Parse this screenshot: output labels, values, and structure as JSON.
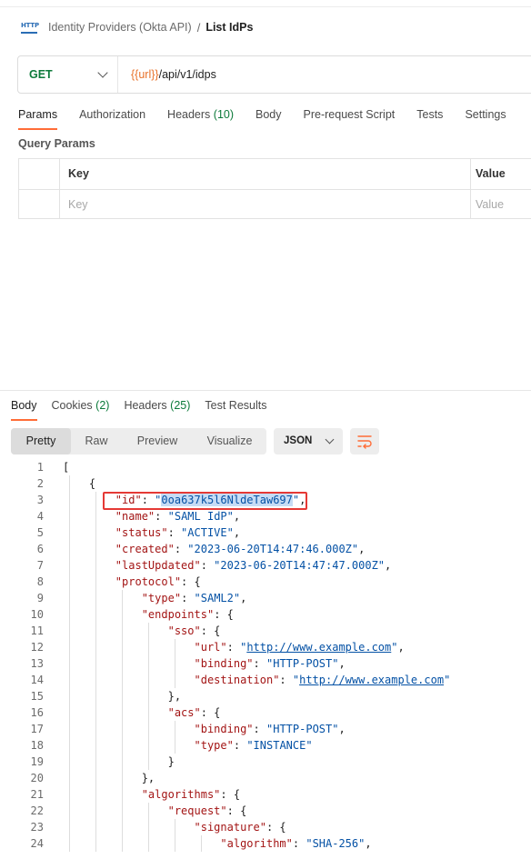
{
  "breadcrumb": {
    "icon": "http-icon",
    "icon_text": "HTTP",
    "parent": "Identity Providers (Okta API)",
    "separator": "/",
    "current": "List IdPs"
  },
  "request": {
    "method": "GET",
    "url_var": "{{url}}",
    "url_path": "/api/v1/idps"
  },
  "request_tabs": [
    {
      "label": "Params",
      "count": ""
    },
    {
      "label": "Authorization",
      "count": ""
    },
    {
      "label": "Headers",
      "count": "(10)"
    },
    {
      "label": "Body",
      "count": ""
    },
    {
      "label": "Pre-request Script",
      "count": ""
    },
    {
      "label": "Tests",
      "count": ""
    },
    {
      "label": "Settings",
      "count": ""
    }
  ],
  "query_params": {
    "title": "Query Params",
    "headers": {
      "key": "Key",
      "value": "Value"
    },
    "placeholders": {
      "key": "Key",
      "value": "Value"
    }
  },
  "response_tabs": [
    {
      "label": "Body",
      "count": ""
    },
    {
      "label": "Cookies",
      "count": "(2)"
    },
    {
      "label": "Headers",
      "count": "(25)"
    },
    {
      "label": "Test Results",
      "count": ""
    }
  ],
  "view_modes": [
    "Pretty",
    "Raw",
    "Preview",
    "Visualize"
  ],
  "format": "JSON",
  "colors": {
    "accent": "#ff6c37",
    "method_get": "#0c7a3a",
    "url_variable": "#e8722a",
    "json_key": "#a31515",
    "json_string": "#0451a5",
    "highlight_box": "#e53935"
  },
  "json": {
    "id": "0oa637k5l6NldeTaw697",
    "name": "SAML IdP",
    "status": "ACTIVE",
    "created": "2023-06-20T14:47:46.000Z",
    "lastUpdated": "2023-06-20T14:47:47.000Z",
    "protocol_type": "SAML2",
    "sso_url": "http://www.example.com",
    "sso_binding": "HTTP-POST",
    "sso_destination": "http://www.example.com",
    "acs_binding": "HTTP-POST",
    "acs_type": "INSTANCE",
    "signature_algorithm": "SHA-256"
  },
  "line_numbers": [
    "1",
    "2",
    "3",
    "4",
    "5",
    "6",
    "7",
    "8",
    "9",
    "10",
    "11",
    "12",
    "13",
    "14",
    "15",
    "16",
    "17",
    "18",
    "19",
    "20",
    "21",
    "22",
    "23",
    "24"
  ]
}
